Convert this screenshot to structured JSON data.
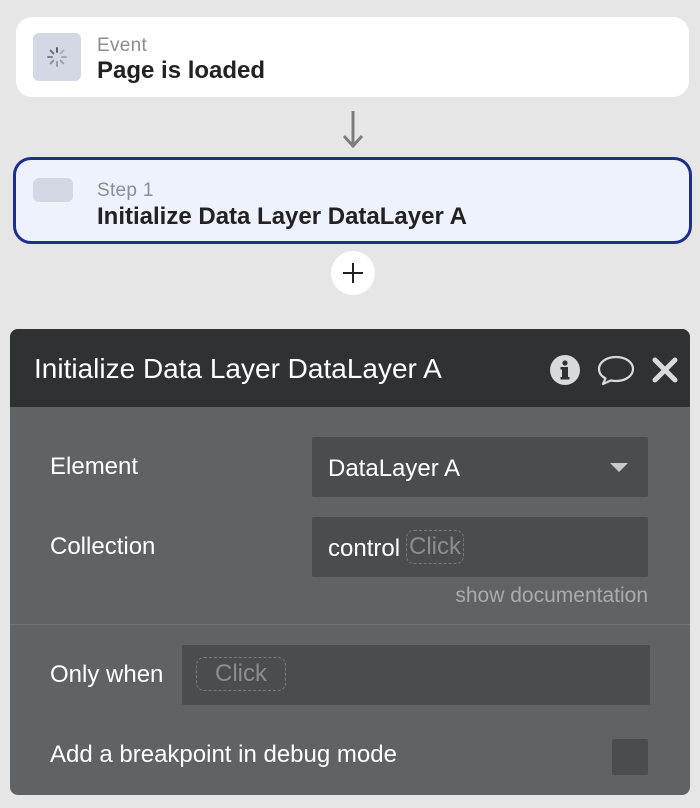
{
  "event": {
    "kicker": "Event",
    "title": "Page is loaded",
    "icon": "loading-spinner-icon"
  },
  "step": {
    "kicker": "Step 1",
    "title": "Initialize Data Layer DataLayer A"
  },
  "panel": {
    "title": "Initialize Data Layer DataLayer A",
    "element_label": "Element",
    "element_value": "DataLayer A",
    "collection_label": "Collection",
    "collection_value": "control",
    "collection_placeholder": "Click",
    "show_documentation": "show documentation",
    "only_when_label": "Only when",
    "only_when_placeholder": "Click",
    "breakpoint_label": "Add a breakpoint in debug mode",
    "breakpoint_checked": false
  },
  "colors": {
    "background": "#e6e6e6",
    "step_border": "#1d2f8c",
    "step_bg": "#eef2fc",
    "panel_bg": "#5f6365",
    "panel_header_bg": "#2e3233",
    "field_bg": "#4a4d50"
  }
}
